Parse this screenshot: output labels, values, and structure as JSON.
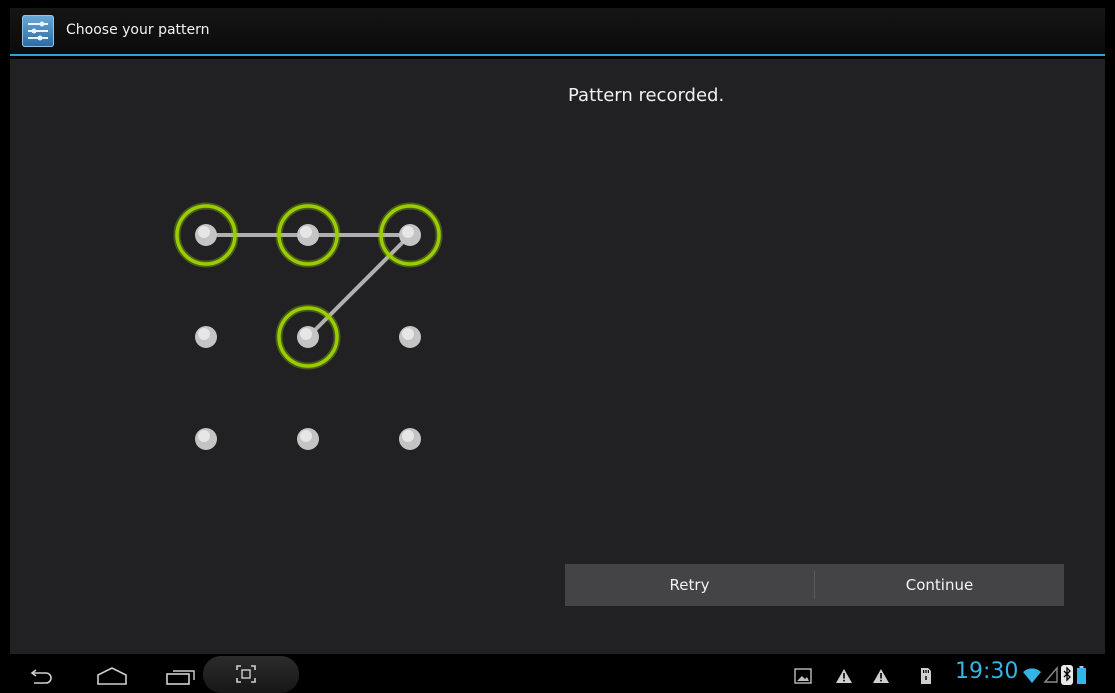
{
  "action_bar": {
    "title": "Choose your pattern",
    "icon": "settings-sliders-icon"
  },
  "main": {
    "header_text": "Pattern recorded.",
    "pattern": {
      "grid": [
        [
          1,
          2,
          3
        ],
        [
          4,
          5,
          6
        ],
        [
          7,
          8,
          9
        ]
      ],
      "selected_sequence": [
        1,
        2,
        3,
        5
      ],
      "ring_color": "#9acd00",
      "line_color": "#c8c8c8"
    },
    "buttons": {
      "retry_label": "Retry",
      "continue_label": "Continue"
    }
  },
  "system_bar": {
    "time": "19:30",
    "accent_color": "#33b5e5",
    "nav_icons": [
      "back-icon",
      "home-icon",
      "recent-apps-icon",
      "screenshot-icon"
    ],
    "notification_icons": [
      "gallery-notification-icon",
      "warning-icon",
      "warning-icon",
      "sd-card-icon"
    ],
    "status_icons": [
      "wifi-icon",
      "signal-icon",
      "bluetooth-icon",
      "battery-icon"
    ]
  }
}
